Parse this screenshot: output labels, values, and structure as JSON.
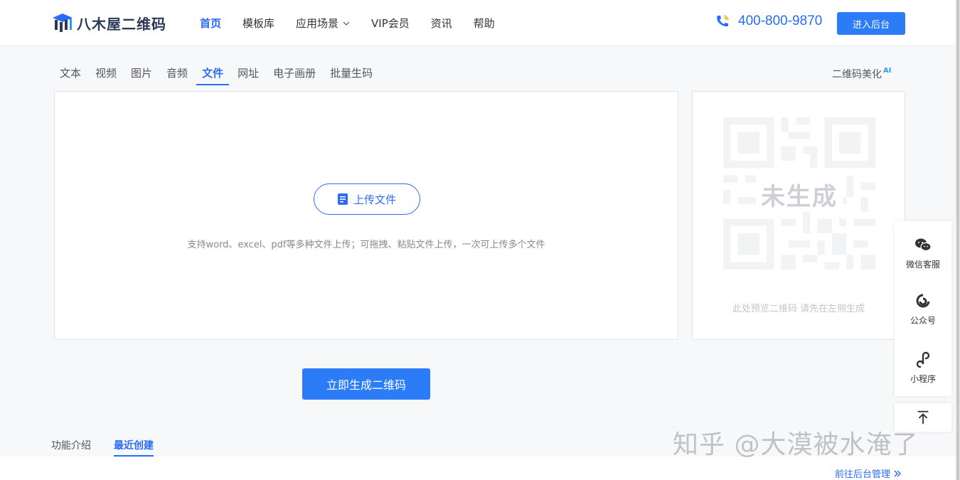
{
  "header": {
    "logo_text": "八木屋二维码",
    "nav": [
      {
        "label": "首页",
        "active": true
      },
      {
        "label": "模板库",
        "active": false
      },
      {
        "label": "应用场景",
        "active": false,
        "dropdown": true
      },
      {
        "label": "VIP会员",
        "active": false
      },
      {
        "label": "资讯",
        "active": false
      },
      {
        "label": "帮助",
        "active": false
      }
    ],
    "phone": "400-800-9870",
    "admin_button": "进入后台"
  },
  "type_tabs": [
    {
      "label": "文本",
      "active": false
    },
    {
      "label": "视频",
      "active": false
    },
    {
      "label": "图片",
      "active": false
    },
    {
      "label": "音频",
      "active": false
    },
    {
      "label": "文件",
      "active": true
    },
    {
      "label": "网址",
      "active": false
    },
    {
      "label": "电子画册",
      "active": false
    },
    {
      "label": "批量生码",
      "active": false
    }
  ],
  "beautify": {
    "label": "二维码美化",
    "badge": "AI"
  },
  "upload": {
    "button_label": "上传文件",
    "hint": "支持word、excel、pdf等多种文件上传；可拖拽、粘贴文件上传，一次可上传多个文件"
  },
  "preview": {
    "status": "未生成",
    "hint": "此处预览二维码 请先在左侧生成"
  },
  "generate_button": "立即生成二维码",
  "side_bar": {
    "items": [
      {
        "label": "微信客服",
        "icon": "wechat-icon"
      },
      {
        "label": "公众号",
        "icon": "official-account-icon"
      },
      {
        "label": "小程序",
        "icon": "mini-program-icon"
      }
    ],
    "top_icon": "back-to-top-icon"
  },
  "info_tabs": [
    {
      "label": "功能介绍",
      "active": false
    },
    {
      "label": "最近创建",
      "active": true
    }
  ],
  "manage_link": "前往后台管理",
  "watermark": "知乎 @大漠被水淹了",
  "colors": {
    "accent": "#2b6cf6",
    "button": "#2b7cf6"
  }
}
